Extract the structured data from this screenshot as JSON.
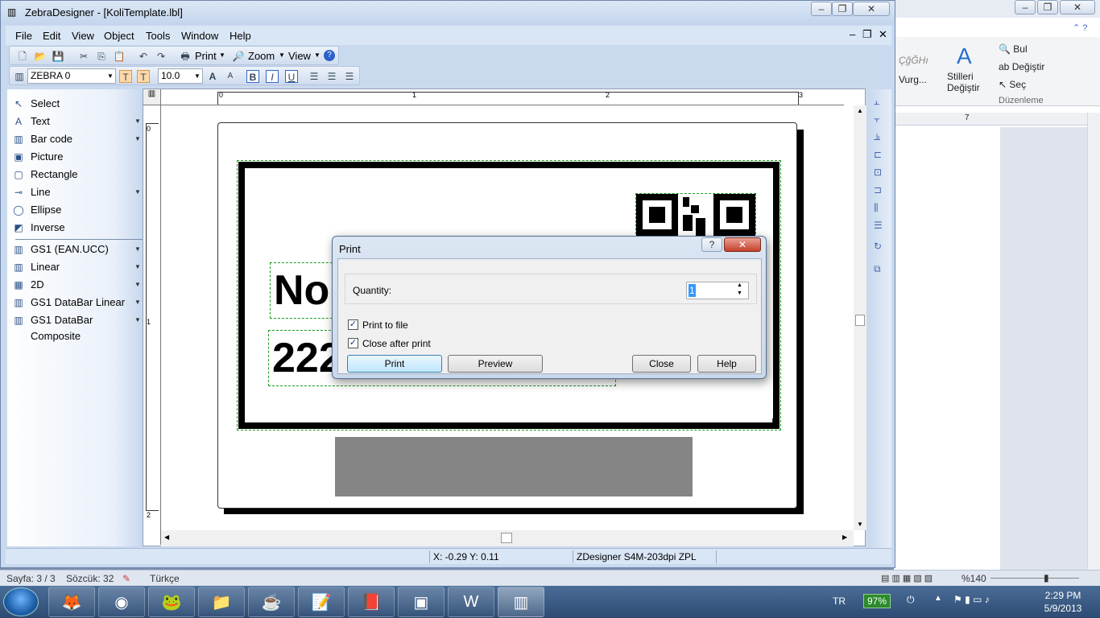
{
  "app": {
    "title": "ZebraDesigner - [KoliTemplate.lbl]",
    "menu": [
      "File",
      "Edit",
      "View",
      "Object",
      "Tools",
      "Window",
      "Help"
    ],
    "toolbar1": {
      "print_label": "Print",
      "zoom_label": "Zoom",
      "view_label": "View"
    },
    "toolbar2": {
      "font_name": "ZEBRA 0",
      "font_size": "10.0"
    },
    "tools": [
      {
        "label": "Select",
        "icon": "select-arrow-icon",
        "arrow": false
      },
      {
        "label": "Text",
        "icon": "text-tool-icon",
        "arrow": true
      },
      {
        "label": "Bar code",
        "icon": "barcode-icon",
        "arrow": true
      },
      {
        "label": "Picture",
        "icon": "picture-icon",
        "arrow": false
      },
      {
        "label": "Rectangle",
        "icon": "rectangle-icon",
        "arrow": false
      },
      {
        "label": "Line",
        "icon": "line-icon",
        "arrow": true
      },
      {
        "label": "Ellipse",
        "icon": "ellipse-icon",
        "arrow": false
      },
      {
        "label": "Inverse",
        "icon": "inverse-icon",
        "arrow": false
      }
    ],
    "barcode_groups": [
      {
        "label": "GS1 (EAN.UCC)"
      },
      {
        "label": "Linear"
      },
      {
        "label": "2D"
      },
      {
        "label": "GS1 DataBar Linear"
      },
      {
        "label": "GS1 DataBar Composite"
      }
    ],
    "rulers": {
      "h": [
        "0",
        "1",
        "2",
        "3"
      ],
      "v": [
        "0",
        "1",
        "2"
      ]
    },
    "label_text": {
      "line1": "No",
      "line2": "222"
    },
    "status": {
      "coords": "X: -0.29 Y:  0.11",
      "printer": "ZDesigner S4M-203dpi ZPL"
    }
  },
  "dialog": {
    "title": "Print",
    "quantity_label": "Quantity:",
    "quantity_value": "1",
    "print_to_file": "Print to file",
    "close_after_print": "Close after print",
    "buttons": {
      "print": "Print",
      "preview": "Preview",
      "close": "Close",
      "help": "Help"
    }
  },
  "word": {
    "styles_sample": "ÇğĞHı",
    "vurgu": "Vurg...",
    "stilleri": "Stilleri",
    "degistir": "Değiştir",
    "bul": "Bul",
    "degistir2": "Değiştir",
    "sec": "Seç",
    "duzenleme": "Düzenleme",
    "ruler_num": "7",
    "status": {
      "page": "Sayfa: 3 / 3",
      "words": "Sözcük: 32",
      "lang": "Türkçe",
      "zoom": "%140"
    }
  },
  "taskbar": {
    "lang": "TR",
    "battery": "97%",
    "time": "2:29 PM",
    "date": "5/9/2013"
  }
}
